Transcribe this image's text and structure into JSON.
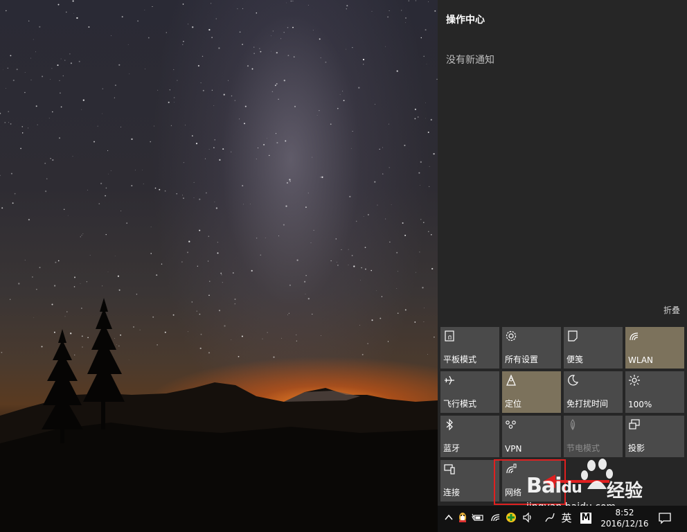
{
  "action_center": {
    "title": "操作中心",
    "empty_text": "没有新通知",
    "collapse_label": "折叠",
    "tiles": [
      {
        "label": "平板模式",
        "icon": "tablet-mode-icon",
        "active": false
      },
      {
        "label": "所有设置",
        "icon": "gear-icon",
        "active": false
      },
      {
        "label": "便笺",
        "icon": "note-icon",
        "active": false
      },
      {
        "label": "WLAN",
        "icon": "wifi-icon",
        "active": true
      },
      {
        "label": "飞行模式",
        "icon": "airplane-icon",
        "active": false
      },
      {
        "label": "定位",
        "icon": "location-icon",
        "active": true
      },
      {
        "label": "免打扰时间",
        "icon": "moon-icon",
        "active": false
      },
      {
        "label": "100%",
        "icon": "brightness-icon",
        "active": false
      },
      {
        "label": "蓝牙",
        "icon": "bluetooth-icon",
        "active": false
      },
      {
        "label": "VPN",
        "icon": "vpn-icon",
        "active": false
      },
      {
        "label": "节电模式",
        "icon": "battery-saver-icon",
        "active": false,
        "disabled": true
      },
      {
        "label": "投影",
        "icon": "project-icon",
        "active": false
      },
      {
        "label": "连接",
        "icon": "connect-icon",
        "active": false
      },
      {
        "label": "网络",
        "icon": "network-icon",
        "active": false
      }
    ]
  },
  "taskbar": {
    "ime_label": "英",
    "m_label": "M",
    "time": "8:52",
    "date": "2016/12/16"
  },
  "watermark": {
    "logo": "Bai",
    "logo_suffix": "du",
    "text": "经验",
    "url": "jingyan.baidu.com"
  },
  "colors": {
    "panel": "#262626",
    "tile": "#4a4a4a",
    "tile_active": "#7c725c",
    "highlight": "#e02020"
  }
}
